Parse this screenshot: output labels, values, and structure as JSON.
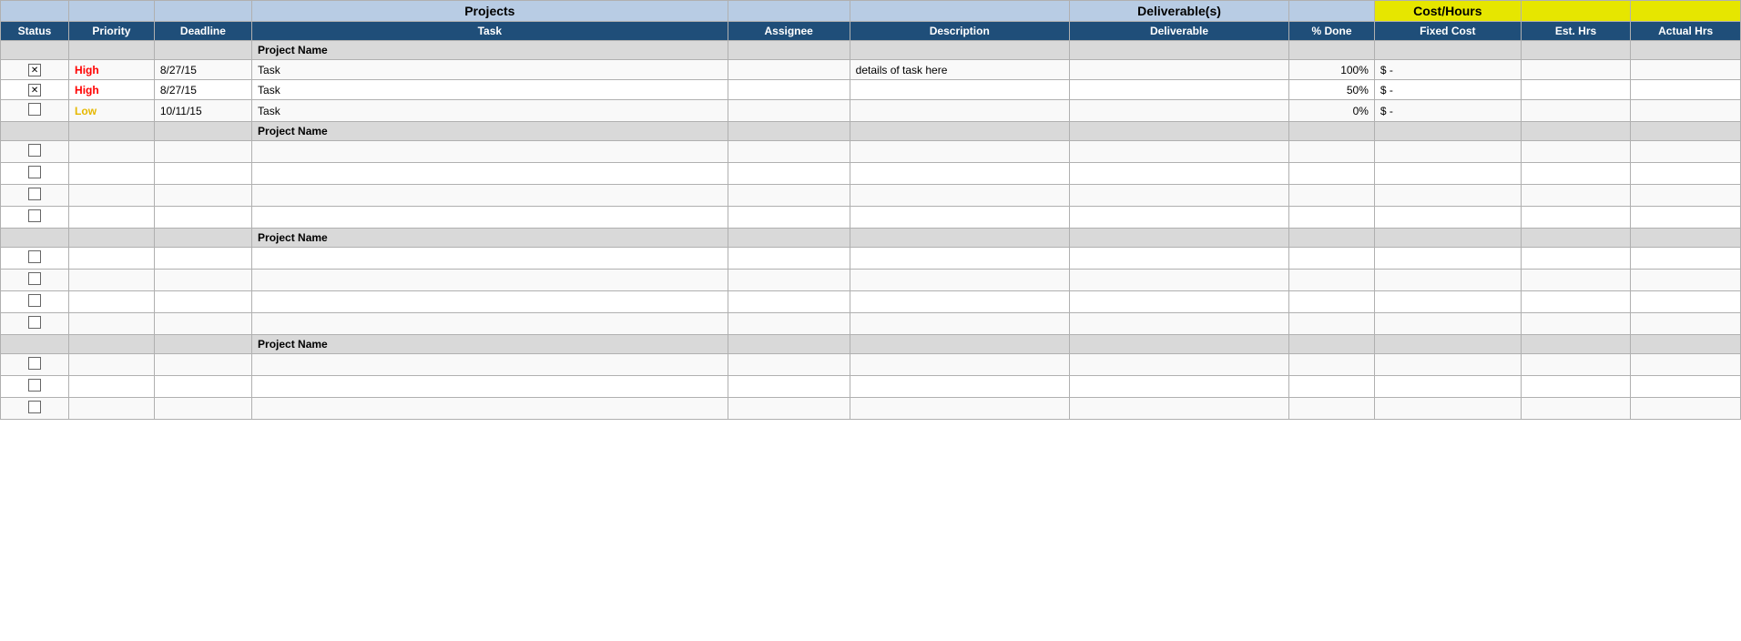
{
  "headers": {
    "group1_label": "Projects",
    "group2_label": "Deliverable(s)",
    "group3_label": "Cost/Hours",
    "col_status": "Status",
    "col_priority": "Priority",
    "col_deadline": "Deadline",
    "col_task": "Task",
    "col_assignee": "Assignee",
    "col_description": "Description",
    "col_deliverable": "Deliverable",
    "col_pctdone": "% Done",
    "col_fixedcost": "Fixed Cost",
    "col_esthrs": "Est. Hrs",
    "col_actualhrs": "Actual Hrs"
  },
  "projects": [
    {
      "name": "Project Name",
      "rows": [
        {
          "status": "checked",
          "priority": "High",
          "priority_class": "priority-high",
          "deadline": "8/27/15",
          "task": "Task",
          "assignee": "",
          "description": "details of task here",
          "deliverable": "",
          "pct_done": "100%",
          "fixed_cost": "$        -",
          "est_hrs": "",
          "actual_hrs": ""
        },
        {
          "status": "checked",
          "priority": "High",
          "priority_class": "priority-high",
          "deadline": "8/27/15",
          "task": "Task",
          "assignee": "",
          "description": "",
          "deliverable": "",
          "pct_done": "50%",
          "fixed_cost": "$        -",
          "est_hrs": "",
          "actual_hrs": ""
        },
        {
          "status": "unchecked",
          "priority": "Low",
          "priority_class": "priority-low",
          "deadline": "10/11/15",
          "task": "Task",
          "assignee": "",
          "description": "",
          "deliverable": "",
          "pct_done": "0%",
          "fixed_cost": "$        -",
          "est_hrs": "",
          "actual_hrs": ""
        }
      ]
    },
    {
      "name": "Project Name",
      "rows": [
        {
          "status": "unchecked",
          "priority": "",
          "priority_class": "",
          "deadline": "",
          "task": "",
          "assignee": "",
          "description": "",
          "deliverable": "",
          "pct_done": "",
          "fixed_cost": "",
          "est_hrs": "",
          "actual_hrs": ""
        },
        {
          "status": "unchecked",
          "priority": "",
          "priority_class": "",
          "deadline": "",
          "task": "",
          "assignee": "",
          "description": "",
          "deliverable": "",
          "pct_done": "",
          "fixed_cost": "",
          "est_hrs": "",
          "actual_hrs": ""
        },
        {
          "status": "unchecked",
          "priority": "",
          "priority_class": "",
          "deadline": "",
          "task": "",
          "assignee": "",
          "description": "",
          "deliverable": "",
          "pct_done": "",
          "fixed_cost": "",
          "est_hrs": "",
          "actual_hrs": ""
        },
        {
          "status": "unchecked",
          "priority": "",
          "priority_class": "",
          "deadline": "",
          "task": "",
          "assignee": "",
          "description": "",
          "deliverable": "",
          "pct_done": "",
          "fixed_cost": "",
          "est_hrs": "",
          "actual_hrs": ""
        }
      ]
    },
    {
      "name": "Project Name",
      "rows": [
        {
          "status": "unchecked",
          "priority": "",
          "priority_class": "",
          "deadline": "",
          "task": "",
          "assignee": "",
          "description": "",
          "deliverable": "",
          "pct_done": "",
          "fixed_cost": "",
          "est_hrs": "",
          "actual_hrs": ""
        },
        {
          "status": "unchecked",
          "priority": "",
          "priority_class": "",
          "deadline": "",
          "task": "",
          "assignee": "",
          "description": "",
          "deliverable": "",
          "pct_done": "",
          "fixed_cost": "",
          "est_hrs": "",
          "actual_hrs": ""
        },
        {
          "status": "unchecked",
          "priority": "",
          "priority_class": "",
          "deadline": "",
          "task": "",
          "assignee": "",
          "description": "",
          "deliverable": "",
          "pct_done": "",
          "fixed_cost": "",
          "est_hrs": "",
          "actual_hrs": ""
        },
        {
          "status": "unchecked",
          "priority": "",
          "priority_class": "",
          "deadline": "",
          "task": "",
          "assignee": "",
          "description": "",
          "deliverable": "",
          "pct_done": "",
          "fixed_cost": "",
          "est_hrs": "",
          "actual_hrs": ""
        }
      ]
    },
    {
      "name": "Project Name",
      "rows": [
        {
          "status": "unchecked",
          "priority": "",
          "priority_class": "",
          "deadline": "",
          "task": "",
          "assignee": "",
          "description": "",
          "deliverable": "",
          "pct_done": "",
          "fixed_cost": "",
          "est_hrs": "",
          "actual_hrs": ""
        },
        {
          "status": "unchecked",
          "priority": "",
          "priority_class": "",
          "deadline": "",
          "task": "",
          "assignee": "",
          "description": "",
          "deliverable": "",
          "pct_done": "",
          "fixed_cost": "",
          "est_hrs": "",
          "actual_hrs": ""
        },
        {
          "status": "unchecked",
          "priority": "",
          "priority_class": "",
          "deadline": "",
          "task": "",
          "assignee": "",
          "description": "",
          "deliverable": "",
          "pct_done": "",
          "fixed_cost": "",
          "est_hrs": "",
          "actual_hrs": ""
        }
      ]
    }
  ]
}
